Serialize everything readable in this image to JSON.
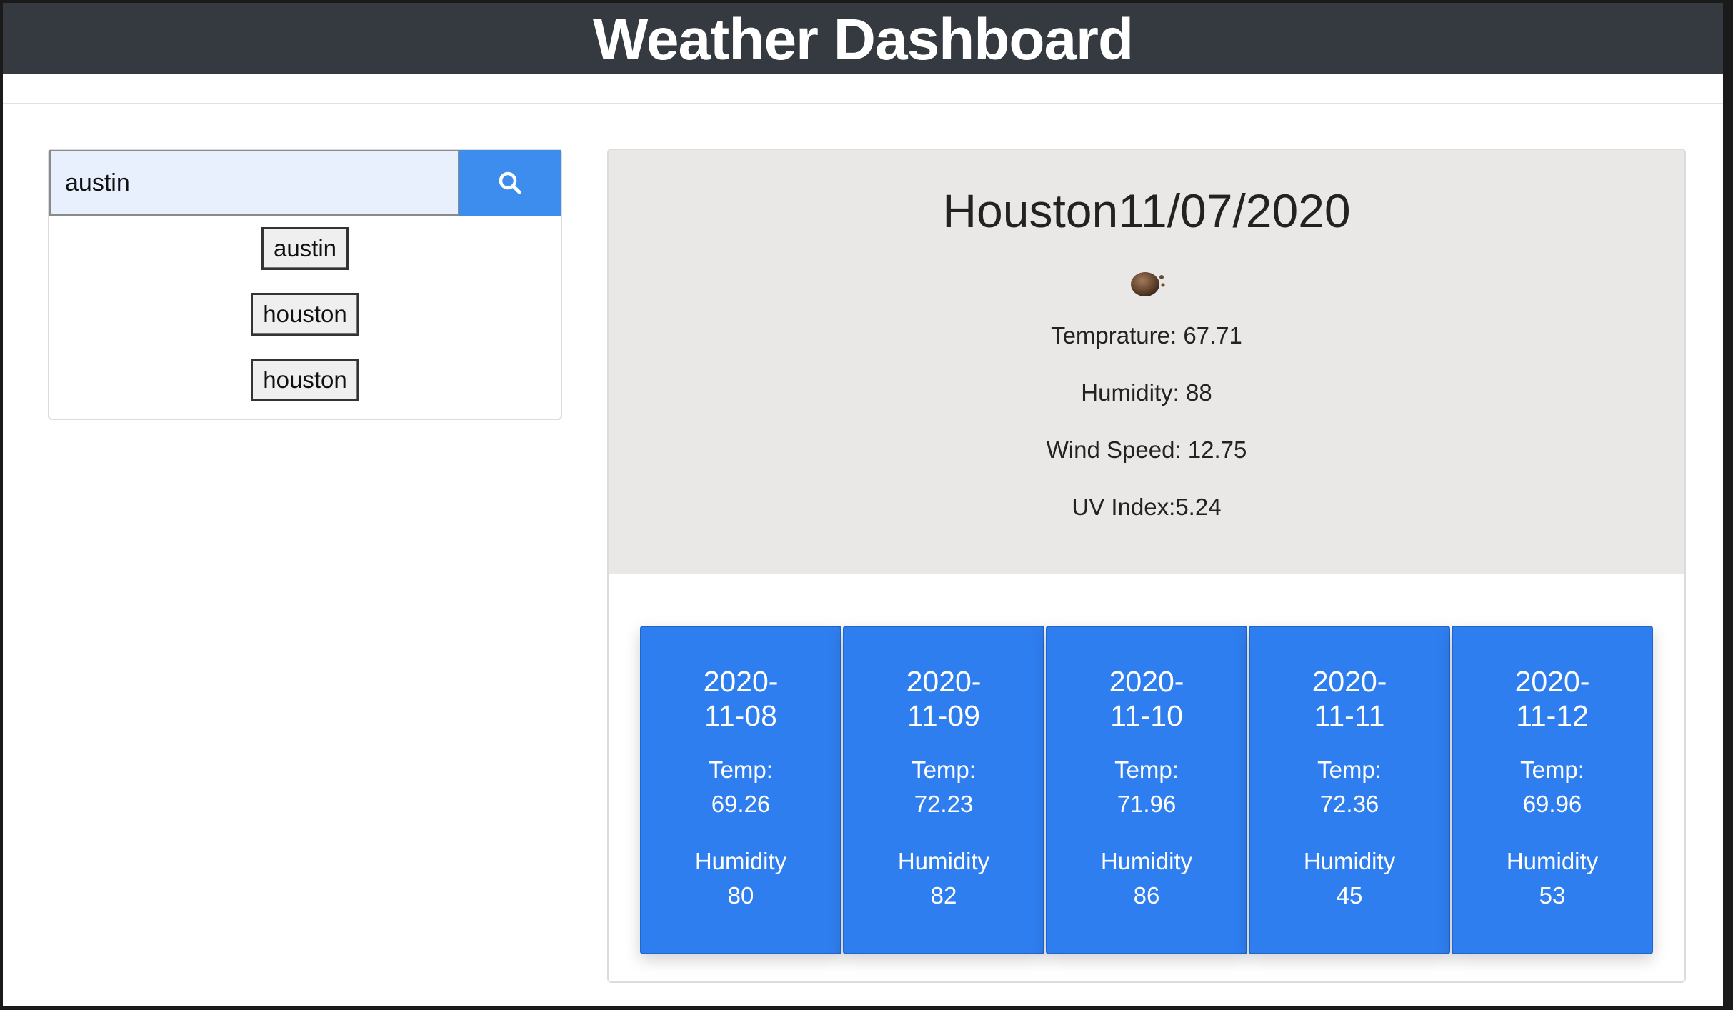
{
  "header": {
    "title": "Weather Dashboard"
  },
  "search": {
    "value": "austin",
    "button_icon": "search-icon",
    "accent_color": "#3d8def"
  },
  "history": [
    {
      "label": "austin"
    },
    {
      "label": "houston"
    },
    {
      "label": "houston"
    }
  ],
  "current": {
    "heading": "Houston11/07/2020",
    "icon": "weather-icon",
    "temperature": "Temprature: 67.71",
    "humidity": "Humidity: 88",
    "wind": "Wind Speed: 12.75",
    "uv": "UV Index:5.24"
  },
  "forecast": [
    {
      "date_line1": "2020-",
      "date_line2": "11-08",
      "temp_label": "Temp:",
      "temp": "69.26",
      "humidity_label": "Humidity",
      "humidity": "80"
    },
    {
      "date_line1": "2020-",
      "date_line2": "11-09",
      "temp_label": "Temp:",
      "temp": "72.23",
      "humidity_label": "Humidity",
      "humidity": "82"
    },
    {
      "date_line1": "2020-",
      "date_line2": "11-10",
      "temp_label": "Temp:",
      "temp": "71.96",
      "humidity_label": "Humidity",
      "humidity": "86"
    },
    {
      "date_line1": "2020-",
      "date_line2": "11-11",
      "temp_label": "Temp:",
      "temp": "72.36",
      "humidity_label": "Humidity",
      "humidity": "45"
    },
    {
      "date_line1": "2020-",
      "date_line2": "11-12",
      "temp_label": "Temp:",
      "temp": "69.96",
      "humidity_label": "Humidity",
      "humidity": "53"
    }
  ],
  "colors": {
    "header_bg": "#343a40",
    "forecast_card": "#2f7ef0",
    "current_bg": "#e9e8e7"
  }
}
